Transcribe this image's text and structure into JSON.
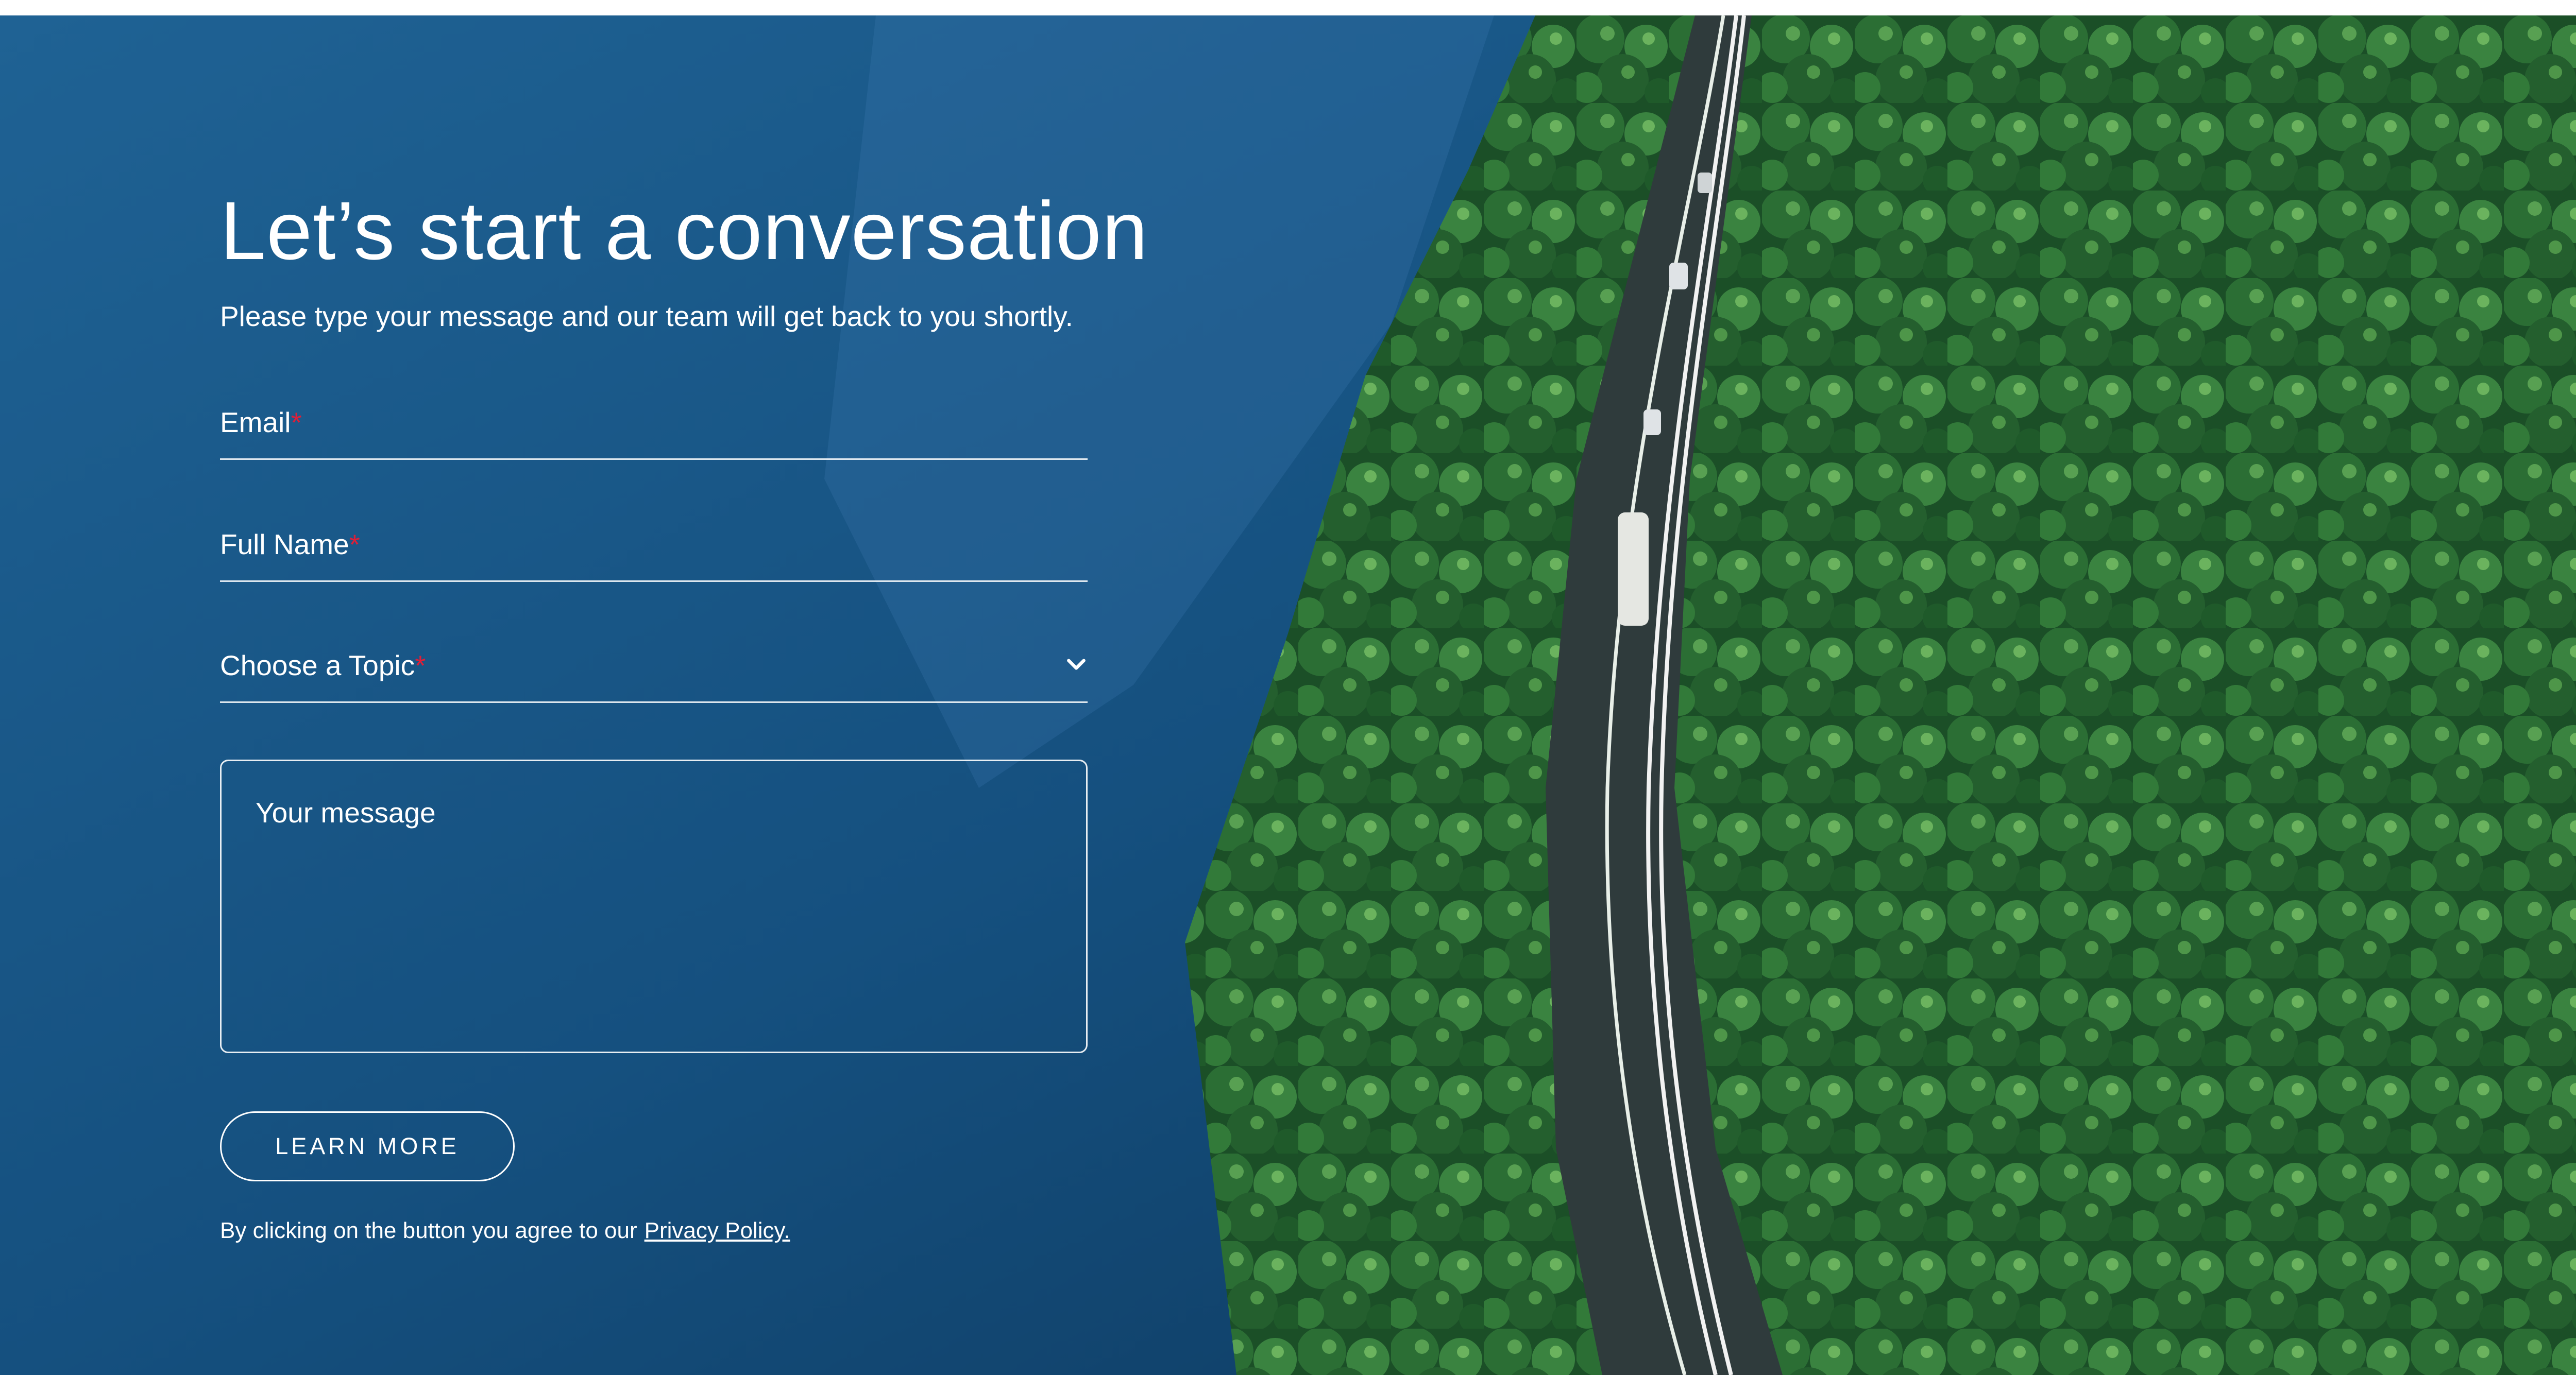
{
  "hero": {
    "title": "Let’s start a conversation",
    "subtitle": "Please type your message and our team will get back to you shortly."
  },
  "form": {
    "email_label": "Email",
    "full_name_label": "Full Name",
    "topic_label": "Choose a Topic",
    "required_marker": "*",
    "message_placeholder": "Your message",
    "submit_label": "LEARN MORE",
    "disclaimer_text": "By clicking on the button you agree to our",
    "privacy_link": "Privacy Policy."
  },
  "icons": {
    "topic_dropdown": "chevron-down-icon"
  },
  "colors": {
    "water": "#15507f",
    "forest": "#1f5a2c",
    "required": "#e01e37",
    "text": "#ffffff"
  }
}
